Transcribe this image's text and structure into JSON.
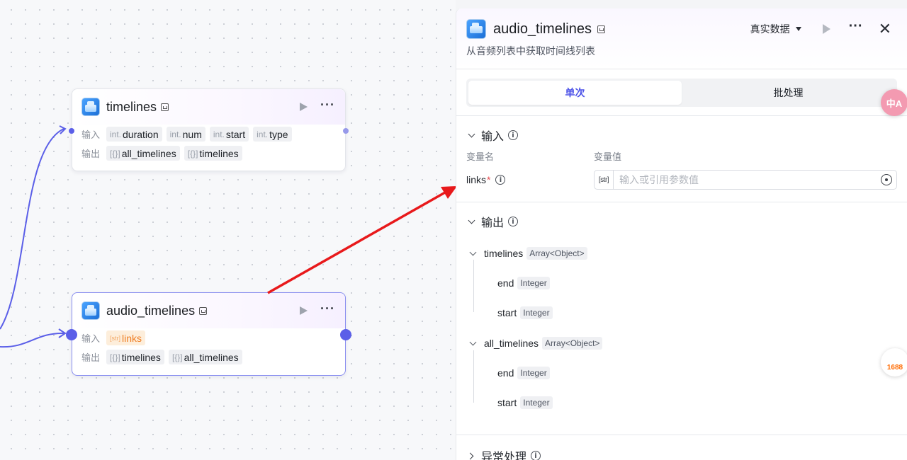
{
  "canvas": {
    "node1": {
      "title": "timelines",
      "input_label": "输入",
      "output_label": "输出",
      "inputs": [
        {
          "type": "int.",
          "name": "duration"
        },
        {
          "type": "int.",
          "name": "num"
        },
        {
          "type": "int.",
          "name": "start"
        },
        {
          "type": "int.",
          "name": "type"
        }
      ],
      "outputs": [
        {
          "type": "[{}]",
          "name": "all_timelines"
        },
        {
          "type": "[{}]",
          "name": "timelines"
        }
      ]
    },
    "node2": {
      "title": "audio_timelines",
      "input_label": "输入",
      "output_label": "输出",
      "inputs": [
        {
          "type": "[str]",
          "name": "links"
        }
      ],
      "outputs": [
        {
          "type": "[{}]",
          "name": "timelines"
        },
        {
          "type": "[{}]",
          "name": "all_timelines"
        }
      ]
    }
  },
  "panel": {
    "title": "audio_timelines",
    "description": "从音频列表中获取时间线列表",
    "data_mode": "真实数据",
    "tabs": [
      "单次",
      "批处理"
    ],
    "active_tab": "单次",
    "input_section": {
      "title": "输入",
      "col_name": "变量名",
      "col_value": "变量值",
      "params": [
        {
          "name": "links",
          "required": "*",
          "type_badge": "[str]",
          "placeholder": "输入或引用参数值"
        }
      ]
    },
    "output_section": {
      "title": "输出",
      "fields": [
        {
          "name": "timelines",
          "type": "Array<Object>",
          "children": [
            {
              "name": "end",
              "type": "Integer"
            },
            {
              "name": "start",
              "type": "Integer"
            }
          ]
        },
        {
          "name": "all_timelines",
          "type": "Array<Object>",
          "children": [
            {
              "name": "end",
              "type": "Integer"
            },
            {
              "name": "start",
              "type": "Integer"
            }
          ]
        }
      ]
    },
    "exception_section": {
      "title": "异常处理"
    }
  },
  "floating": {
    "translate_label": "中A",
    "ext_label": "1688"
  },
  "colors": {
    "accent": "#4d53e8",
    "edge": "#5b5fe8",
    "arrow": "#e8191b",
    "warn_tag": "#ef7d22"
  }
}
